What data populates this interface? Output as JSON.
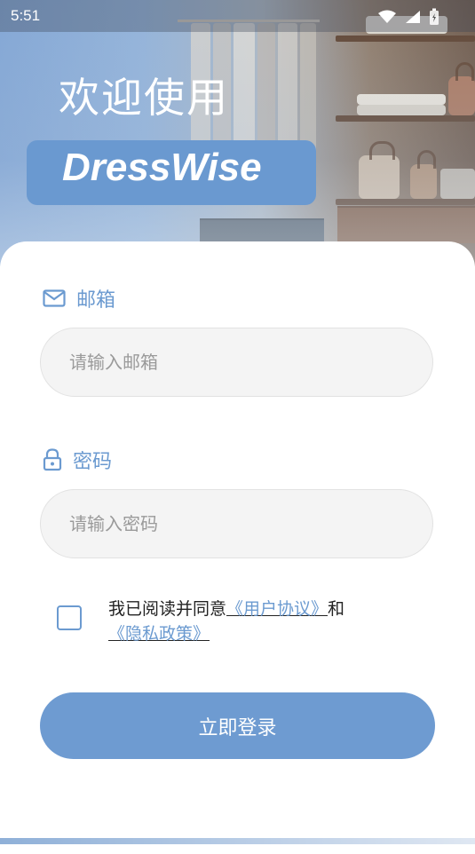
{
  "status_bar": {
    "time": "5:51",
    "icons": [
      "wifi-icon",
      "signal-icon",
      "battery-icon"
    ]
  },
  "header": {
    "welcome": "欢迎使用",
    "brand": "DressWise"
  },
  "form": {
    "email": {
      "label": "邮箱",
      "icon": "mail-icon",
      "placeholder": "请输入邮箱",
      "value": ""
    },
    "password": {
      "label": "密码",
      "icon": "lock-icon",
      "placeholder": "请输入密码",
      "value": ""
    },
    "agreement": {
      "checked": false,
      "prefix": "我已阅读并同意",
      "user_agreement": "《用户协议》",
      "connector": "和",
      "privacy_policy": "《隐私政策》"
    },
    "login_label": "立即登录"
  },
  "colors": {
    "accent": "#6b9ad0",
    "button": "#6e9bd1",
    "input_bg": "#f4f4f4"
  }
}
